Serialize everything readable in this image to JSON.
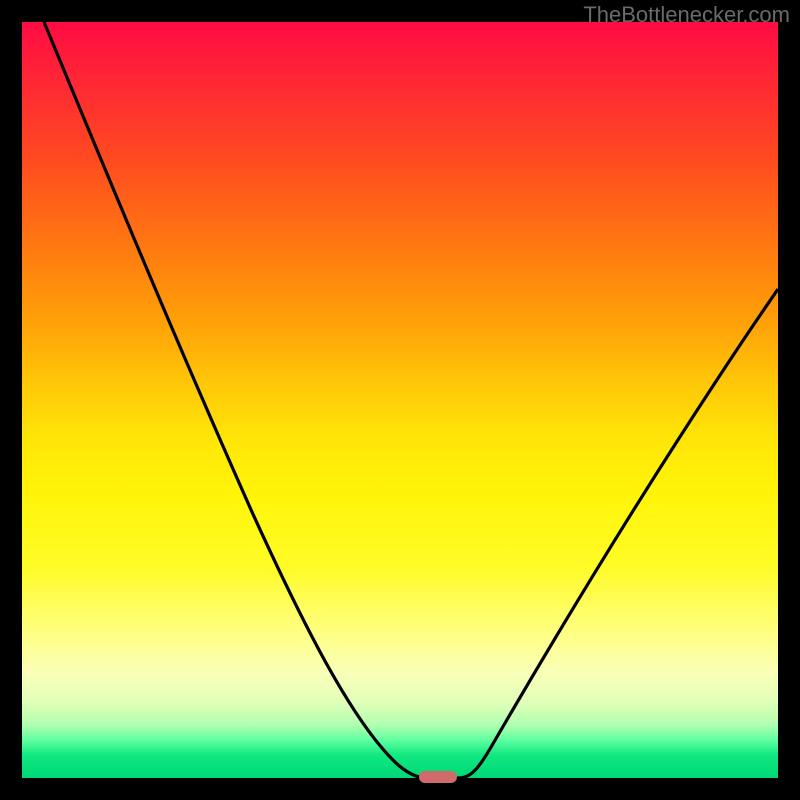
{
  "attribution": "TheBottlenecker.com",
  "chart_data": {
    "type": "line",
    "title": "",
    "xlabel": "",
    "ylabel": "",
    "xlim": [
      0,
      100
    ],
    "ylim": [
      0,
      100
    ],
    "x": [
      3,
      8,
      13,
      18,
      23,
      28,
      33,
      38,
      43,
      48,
      51,
      53,
      55,
      57,
      60,
      64,
      68,
      73,
      78,
      83,
      88,
      93,
      98,
      100
    ],
    "y": [
      100,
      91,
      82,
      73,
      64,
      55,
      46,
      37,
      27,
      15,
      6,
      1,
      0,
      0,
      2,
      9,
      17,
      25,
      33,
      41,
      49,
      57,
      64,
      67
    ],
    "marker": {
      "x_start": 53,
      "x_end": 57,
      "y": 0
    },
    "background_gradient": {
      "top": "#ff0b42",
      "mid": "#fff408",
      "bottom": "#00d878"
    }
  }
}
